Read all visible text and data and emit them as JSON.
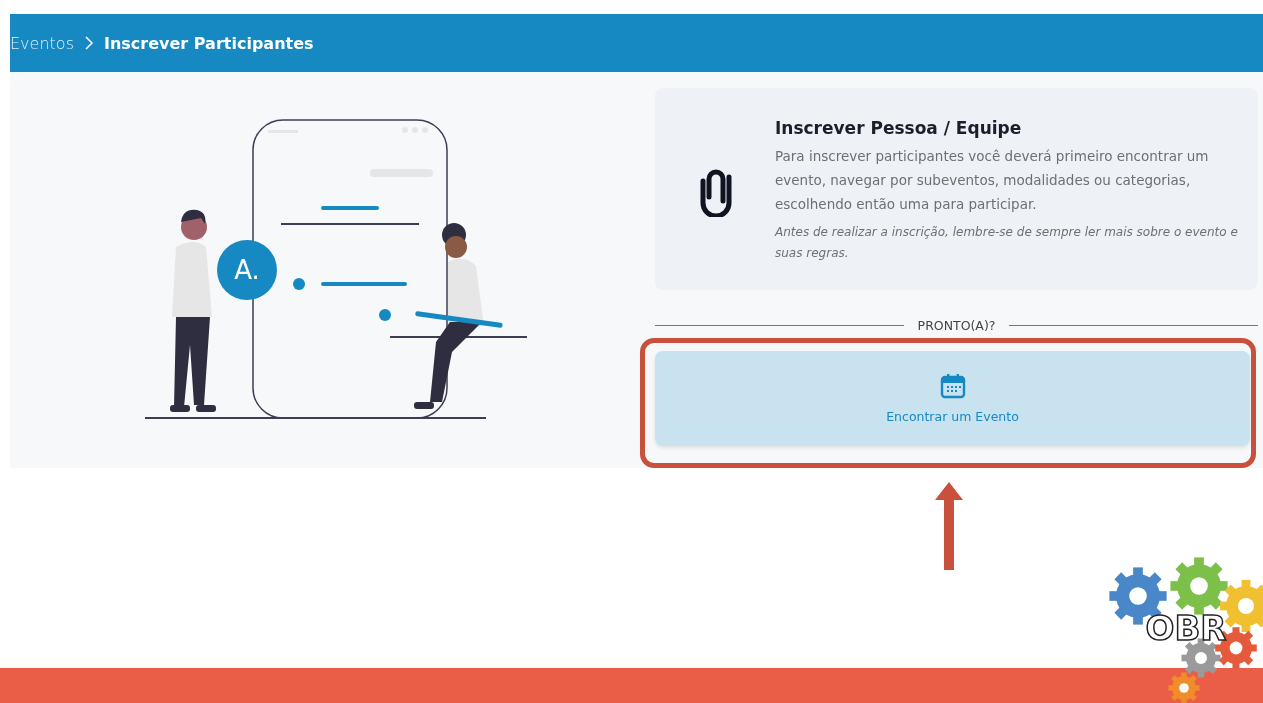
{
  "breadcrumb": [
    {
      "label": "Eventos",
      "current": false
    },
    {
      "label": "Inscrever Participantes",
      "current": true
    }
  ],
  "illustration": {
    "badge": "A."
  },
  "info_card": {
    "title": "Inscrever Pessoa / Equipe",
    "description": "Para inscrever participantes você deverá primeiro encontrar um evento, navegar por subeventos, modalidades ou categorias, escolhendo então uma para participar.",
    "note": "Antes de realizar a inscrição, lembre-se de sempre ler mais sobre o evento e suas regras."
  },
  "divider_label": "PRONTO(A)?",
  "action_button": {
    "label": "Encontrar um Evento"
  },
  "logo": {
    "text": "OBR"
  }
}
